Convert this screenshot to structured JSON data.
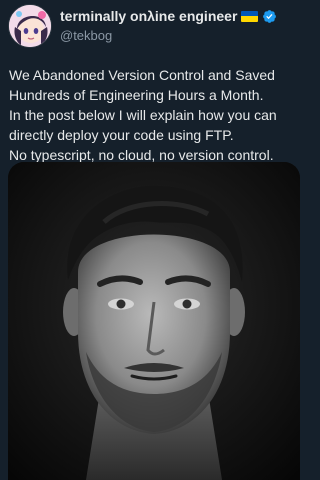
{
  "author": {
    "display_name": "terminally onλine engineer",
    "handle": "@tekbog",
    "flag_colors": [
      "#0057b7",
      "#ffd700"
    ],
    "verified_color": "#1d9bf0"
  },
  "tweet": {
    "paragraphs": [
      "We Abandoned Version Control and Saved Hundreds of Engineering Hours a Month.",
      "In the post below I will explain how you can directly deploy your code using FTP.",
      "No typescript, no cloud, no version control."
    ]
  },
  "media": {
    "kind": "portrait-photo",
    "subject": "black-and-white close-up portrait of a man"
  },
  "icons": {
    "avatar": "anime-avatar-icon",
    "flag": "ukraine-flag-icon",
    "verified": "verified-badge-icon"
  }
}
